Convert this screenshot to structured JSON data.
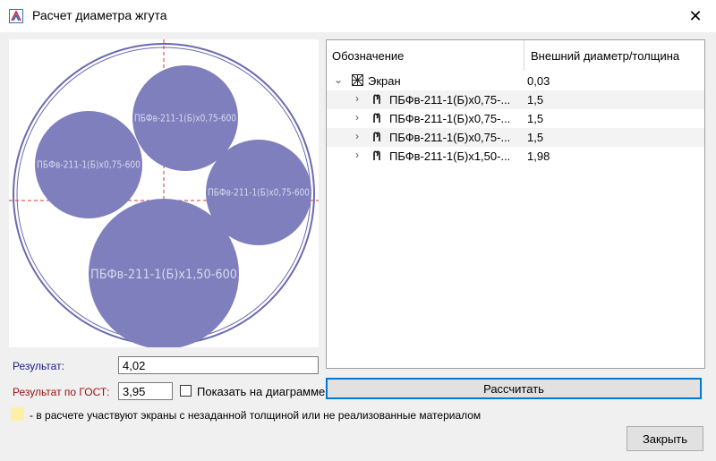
{
  "window": {
    "title": "Расчет диаметра жгута",
    "close_glyph": "✕",
    "app_icon": "harness-app-icon"
  },
  "diagram": {
    "bundle_color": "#7f7fbd",
    "outer_ring_color": "#6a6ab0",
    "axis_color": "#e03030",
    "circles": [
      {
        "label": "ПБФв-211-1(Б)х0,75-600"
      },
      {
        "label": "ПБФв-211-1(Б)х0,75-600"
      },
      {
        "label": "ПБФв-211-1(Б)х0,75-600"
      },
      {
        "label": "ПБФв-211-1(Б)х1,50-600"
      }
    ]
  },
  "tree": {
    "columns": [
      "Обозначение",
      "Внешний диаметр/толщина"
    ],
    "rows": [
      {
        "expander": "⌄",
        "icon": "screen-icon",
        "name": "Экран",
        "value": "0,03",
        "level": 0
      },
      {
        "expander": "›",
        "icon": "wire-icon",
        "name": "ПБФв-211-1(Б)х0,75-...",
        "value": "1,5",
        "level": 1
      },
      {
        "expander": "›",
        "icon": "wire-icon",
        "name": "ПБФв-211-1(Б)х0,75-...",
        "value": "1,5",
        "level": 1
      },
      {
        "expander": "›",
        "icon": "wire-icon",
        "name": "ПБФв-211-1(Б)х0,75-...",
        "value": "1,5",
        "level": 1
      },
      {
        "expander": "›",
        "icon": "wire-icon",
        "name": "ПБФв-211-1(Б)х1,50-...",
        "value": "1,98",
        "level": 1
      }
    ]
  },
  "result": {
    "label": "Результат:",
    "value": "4,02",
    "gost_label": "Результат по ГОСТ:",
    "gost_value": "3,95",
    "show_label": "Показать на диаграмме",
    "show_checked": false
  },
  "buttons": {
    "calculate": "Рассчитать",
    "close": "Закрыть"
  },
  "legend": {
    "text": "- в расчете участвуют экраны с незаданной толщиной или не реализованные материалом",
    "swatch_color": "#fdf0a6"
  }
}
